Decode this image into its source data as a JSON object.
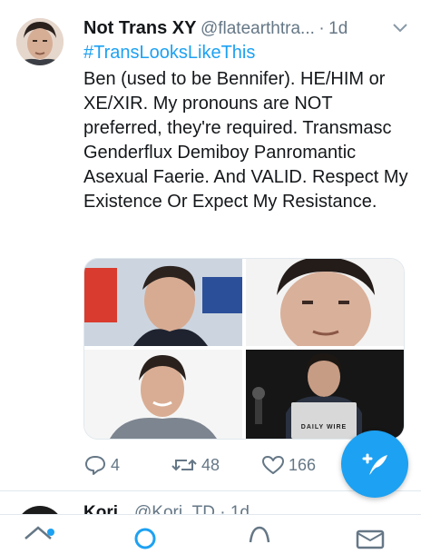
{
  "tweet": {
    "author_name": "Not Trans XY",
    "handle": "@flatearthtra...",
    "separator": "·",
    "time": "1d",
    "hashtag": "#TransLooksLikeThis",
    "text": "Ben (used to be Bennifer).  HE/HIM or XE/XIR.  My pronouns are NOT preferred, they're required.  Transmasc Genderflux Demiboy Panromantic Asexual Faerie.  And VALID.  Respect My Existence Or Expect My Resistance.",
    "media_caption": "DAILY WIRE",
    "reply_count": "4",
    "retweet_count": "48",
    "like_count": "166"
  },
  "next_tweet": {
    "author_name": "Kori",
    "handle": "@Kori_TD · 1d"
  },
  "icons": {
    "more": "chevron-down-icon",
    "reply": "reply-icon",
    "retweet": "retweet-icon",
    "like": "heart-icon",
    "compose": "compose-tweet-icon",
    "tabs": [
      "home-icon",
      "search-icon",
      "notifications-icon",
      "messages-icon"
    ]
  },
  "colors": {
    "accent": "#1da1f2",
    "secondary_text": "#657786",
    "text": "#14171a"
  }
}
